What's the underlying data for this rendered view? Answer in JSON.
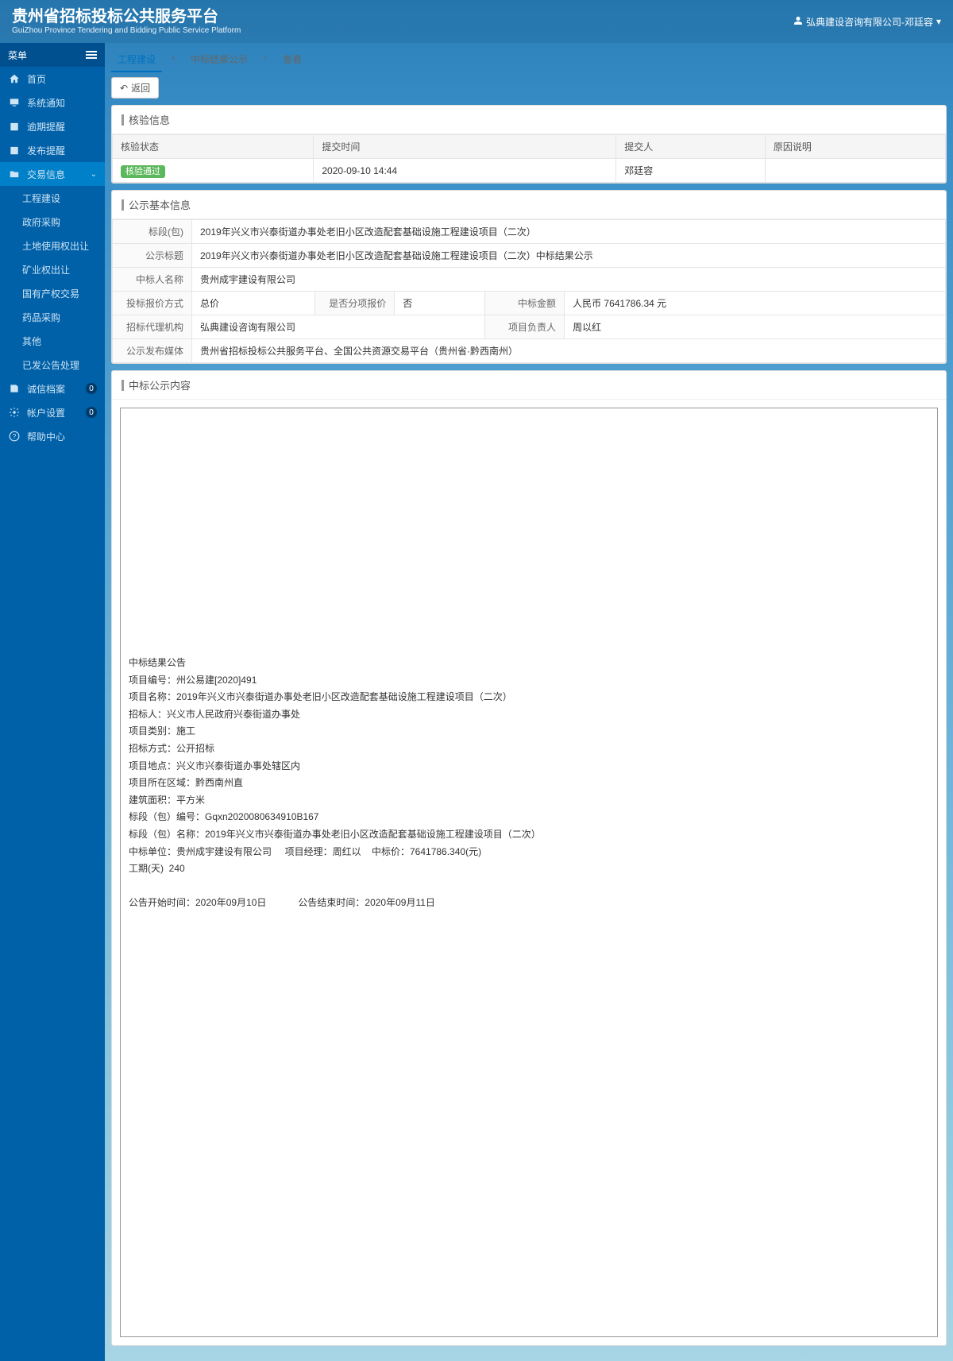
{
  "header": {
    "title_cn": "贵州省招标投标公共服务平台",
    "title_en": "GuiZhou Province Tendering and Bidding Public Service Platform",
    "user": "弘典建设咨询有限公司-邓廷容"
  },
  "sidebar": {
    "menu_label": "菜单",
    "items": {
      "home": "首页",
      "notice": "系统通知",
      "overdue": "逾期提醒",
      "publish": "发布提醒",
      "trade": "交易信息",
      "credit": "诚信档案",
      "account": "帐户设置",
      "help": "帮助中心"
    },
    "trade_sub": {
      "construction": "工程建设",
      "gov": "政府采购",
      "land": "土地使用权出让",
      "mining": "矿业权出让",
      "state": "国有产权交易",
      "drug": "药品采购",
      "other": "其他",
      "processed": "已发公告处理"
    },
    "badges": {
      "credit": "0",
      "account": "0"
    }
  },
  "breadcrumb": {
    "l1": "工程建设",
    "l2": "中标结果公示",
    "l3": "查看",
    "sep": "›"
  },
  "back_btn": "返回",
  "check_section": {
    "title": "核验信息",
    "headers": {
      "status": "核验状态",
      "time": "提交时间",
      "submitter": "提交人",
      "reason": "原因说明"
    },
    "row": {
      "status": "核验通过",
      "time": "2020-09-10 14:44",
      "submitter": "邓廷容",
      "reason": ""
    }
  },
  "basic_section": {
    "title": "公示基本信息",
    "labels": {
      "segment": "标段(包)",
      "notice_title": "公示标题",
      "winner_name": "中标人名称",
      "quote_method": "投标报价方式",
      "split_quote": "是否分项报价",
      "win_amount": "中标金额",
      "agent": "招标代理机构",
      "pm": "项目负责人",
      "media": "公示发布媒体"
    },
    "values": {
      "segment": "2019年兴义市兴泰街道办事处老旧小区改造配套基础设施工程建设项目（二次）",
      "notice_title": "2019年兴义市兴泰街道办事处老旧小区改造配套基础设施工程建设项目（二次）中标结果公示",
      "winner_name": "贵州成宇建设有限公司",
      "quote_method": "总价",
      "split_quote": "否",
      "win_amount": "人民币 7641786.34 元",
      "agent": "弘典建设咨询有限公司",
      "pm": "周以红",
      "media": "贵州省招标投标公共服务平台、全国公共资源交易平台（贵州省·黔西南州）"
    }
  },
  "content_section": {
    "title": "中标公示内容",
    "lines": {
      "a": "中标结果公告",
      "b": "项目编号：州公易建[2020]491",
      "c": "项目名称：2019年兴义市兴泰街道办事处老旧小区改造配套基础设施工程建设项目（二次）",
      "d": "招标人：兴义市人民政府兴泰街道办事处",
      "e": "项目类别：施工",
      "f": "招标方式：公开招标",
      "g": "项目地点：兴义市兴泰街道办事处辖区内",
      "h": "项目所在区域：黔西南州直",
      "i": "建筑面积：平方米",
      "j": "标段（包）编号：Gqxn2020080634910B167",
      "k": " 标段（包）名称：2019年兴义市兴泰街道办事处老旧小区改造配套基础设施工程建设项目（二次）",
      "l": " 中标单位：贵州成宇建设有限公司     项目经理：周红以    中标价：7641786.340(元)",
      "m": "工期(天)  240",
      "n": "公告开始时间：2020年09月10日            公告结束时间：2020年09月11日"
    }
  }
}
